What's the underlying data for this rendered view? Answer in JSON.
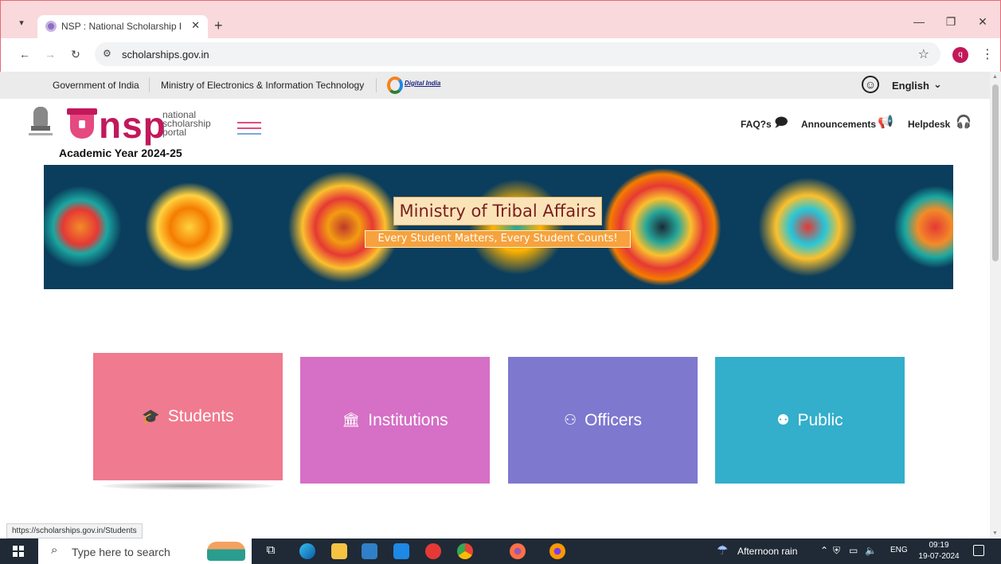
{
  "browser": {
    "tab_title": "NSP : National Scholarship Port",
    "tab_close": "✕",
    "new_tab": "+",
    "url": "scholarships.gov.in",
    "profile_initial": "q",
    "status_url": "https://scholarships.gov.in/Students"
  },
  "gov_strip": {
    "links": [
      "Government of India",
      "Ministry of Electronics & Information Technology"
    ],
    "digital_india": "Digital India",
    "language": "English"
  },
  "header": {
    "logo_word": "nsp",
    "logo_sub_1": "national",
    "logo_sub_2": "scholarship",
    "logo_sub_3": "portal",
    "academic_year": "Academic Year 2024-25",
    "faq": "FAQ?s",
    "announcements": "Announcements",
    "helpdesk": "Helpdesk"
  },
  "banner": {
    "title": "Ministry of Tribal Affairs",
    "tagline": "Every Student Matters, Every Student Counts!"
  },
  "tiles": [
    {
      "label": "Students",
      "icon": "graduation-cap-icon",
      "color": "#f07a8f"
    },
    {
      "label": "Institutions",
      "icon": "institution-icon",
      "color": "#d66fc6"
    },
    {
      "label": "Officers",
      "icon": "user-icon",
      "color": "#7e78cf"
    },
    {
      "label": "Public",
      "icon": "users-icon",
      "color": "#33aecb"
    }
  ],
  "taskbar": {
    "search_placeholder": "Type here to search",
    "weather": "Afternoon rain",
    "lang": "ENG",
    "time": "09:19",
    "date": "19-07-2024"
  }
}
